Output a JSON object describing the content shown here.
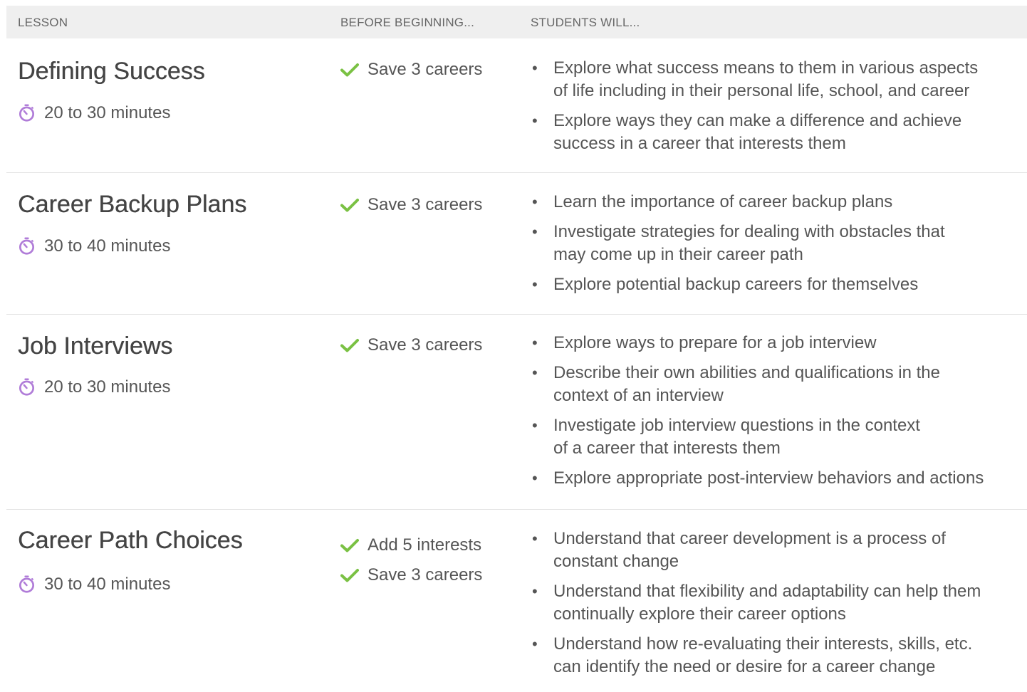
{
  "header": {
    "lesson": "LESSON",
    "before": "BEFORE BEGINNING...",
    "students": "STUDENTS WILL..."
  },
  "colors": {
    "check": "#7ac143",
    "stopwatch": "#b07cd8",
    "header_bg": "#efefef"
  },
  "lessons": [
    {
      "title": "Defining Success",
      "duration": "20 to 30 minutes",
      "prereqs": [
        "Save 3 careers"
      ],
      "objectives": [
        [
          "Explore what success means to them in various aspects",
          "of life including in their personal life, school, and career"
        ],
        [
          "Explore ways they can make a difference and achieve",
          "success in a career that interests them"
        ]
      ]
    },
    {
      "title": "Career Backup Plans",
      "duration": "30 to 40 minutes",
      "prereqs": [
        "Save 3 careers"
      ],
      "objectives": [
        [
          "Learn the importance of career backup plans"
        ],
        [
          "Investigate strategies for dealing with obstacles that",
          "may come up in their career path"
        ],
        [
          "Explore potential backup careers for themselves"
        ]
      ]
    },
    {
      "title": "Job Interviews",
      "duration": "20 to 30 minutes",
      "prereqs": [
        "Save 3 careers"
      ],
      "objectives": [
        [
          "Explore ways to prepare for a job interview"
        ],
        [
          "Describe their own abilities and qualifications in the",
          "context of an interview"
        ],
        [
          "Investigate job interview questions in the context",
          "of a career that interests them"
        ],
        [
          "Explore appropriate post-interview behaviors and actions"
        ]
      ]
    },
    {
      "title": "Career Path Choices",
      "duration": "30 to 40 minutes",
      "prereqs": [
        "Add 5 interests",
        "Save 3 careers"
      ],
      "objectives": [
        [
          "Understand that career development is a process of",
          "constant change"
        ],
        [
          "Understand that flexibility and adaptability can help them",
          "continually explore their career options"
        ],
        [
          "Understand how re-evaluating their interests, skills, etc.",
          "can identify the need or desire for a career change"
        ]
      ]
    }
  ]
}
